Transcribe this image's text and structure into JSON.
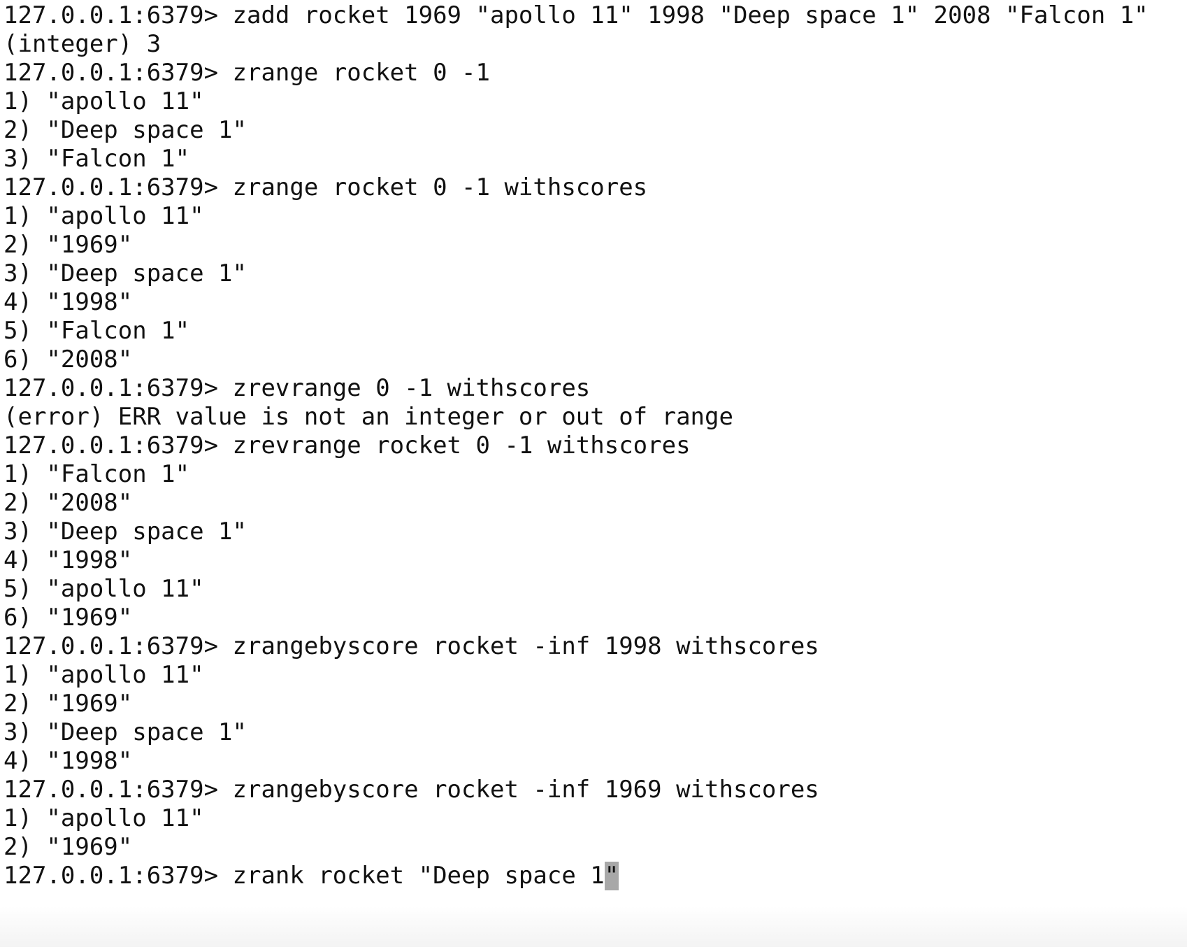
{
  "terminal": {
    "prompt": "127.0.0.1:6379> ",
    "lines": [
      {
        "type": "command",
        "text": "zadd rocket 1969 \"apollo 11\" 1998 \"Deep space 1\" 2008 \"Falcon 1\""
      },
      {
        "type": "output",
        "text": "(integer) 3"
      },
      {
        "type": "command",
        "text": "zrange rocket 0 -1"
      },
      {
        "type": "output",
        "text": "1) \"apollo 11\""
      },
      {
        "type": "output",
        "text": "2) \"Deep space 1\""
      },
      {
        "type": "output",
        "text": "3) \"Falcon 1\""
      },
      {
        "type": "command",
        "text": "zrange rocket 0 -1 withscores"
      },
      {
        "type": "output",
        "text": "1) \"apollo 11\""
      },
      {
        "type": "output",
        "text": "2) \"1969\""
      },
      {
        "type": "output",
        "text": "3) \"Deep space 1\""
      },
      {
        "type": "output",
        "text": "4) \"1998\""
      },
      {
        "type": "output",
        "text": "5) \"Falcon 1\""
      },
      {
        "type": "output",
        "text": "6) \"2008\""
      },
      {
        "type": "command",
        "text": "zrevrange 0 -1 withscores"
      },
      {
        "type": "output",
        "text": "(error) ERR value is not an integer or out of range"
      },
      {
        "type": "command",
        "text": "zrevrange rocket 0 -1 withscores"
      },
      {
        "type": "output",
        "text": "1) \"Falcon 1\""
      },
      {
        "type": "output",
        "text": "2) \"2008\""
      },
      {
        "type": "output",
        "text": "3) \"Deep space 1\""
      },
      {
        "type": "output",
        "text": "4) \"1998\""
      },
      {
        "type": "output",
        "text": "5) \"apollo 11\""
      },
      {
        "type": "output",
        "text": "6) \"1969\""
      },
      {
        "type": "command",
        "text": "zrangebyscore rocket -inf 1998 withscores"
      },
      {
        "type": "output",
        "text": "1) \"apollo 11\""
      },
      {
        "type": "output",
        "text": "2) \"1969\""
      },
      {
        "type": "output",
        "text": "3) \"Deep space 1\""
      },
      {
        "type": "output",
        "text": "4) \"1998\""
      },
      {
        "type": "command",
        "text": "zrangebyscore rocket -inf 1969 withscores"
      },
      {
        "type": "output",
        "text": "1) \"apollo 11\""
      },
      {
        "type": "output",
        "text": "2) \"1969\""
      }
    ],
    "current_input": {
      "before_cursor": "zrank rocket \"Deep space 1",
      "cursor_char": "\""
    }
  },
  "colors": {
    "background": "#ffffff",
    "text": "#111111",
    "cursor": "#a8a8a8"
  }
}
